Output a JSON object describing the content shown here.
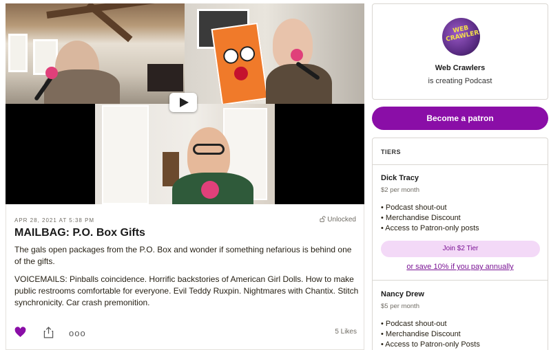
{
  "post": {
    "date": "APR 28, 2021 AT 5:38 PM",
    "lock_status": "Unlocked",
    "title": "MAILBAG: P.O. Box Gifts",
    "description": "The gals open packages from the P.O. Box and wonder if something nefarious is behind one of the gifts.",
    "voicemails": "VOICEMAILS: Pinballs coincidence. Horrific backstories of American Girl Dolls. How to make public restrooms comfortable for everyone. Evil Teddy Ruxpin. Nightmares with Chantix. Stitch synchronicity. Car crash premonition.",
    "likes": "5 Likes",
    "more_label": "ooo"
  },
  "creator": {
    "logo_text": "WEB CRAWLERS",
    "name": "Web Crawlers",
    "subtitle": "is creating Podcast",
    "become_patron_label": "Become a patron"
  },
  "tiers": {
    "header": "TIERS",
    "items": [
      {
        "name": "Dick Tracy",
        "price": "$2 per month",
        "benefits": [
          "• Podcast shout-out",
          "• Merchandise Discount",
          "• Access to Patron-only posts"
        ],
        "join_label": "Join $2 Tier",
        "save_label": "or save 10% if you pay annually"
      },
      {
        "name": "Nancy Drew",
        "price": "$5 per month",
        "benefits": [
          "• Podcast shout-out",
          "• Merchandise Discount",
          "• Access to Patron-only Posts"
        ]
      }
    ]
  },
  "colors": {
    "brand": "#8a0ea7",
    "join_bg": "#f3d9f7",
    "like": "#8a0ea7"
  },
  "icons": {
    "play": "play-icon",
    "like": "heart-icon",
    "share": "share-icon",
    "more": "more-icon",
    "lock": "unlock-icon"
  }
}
